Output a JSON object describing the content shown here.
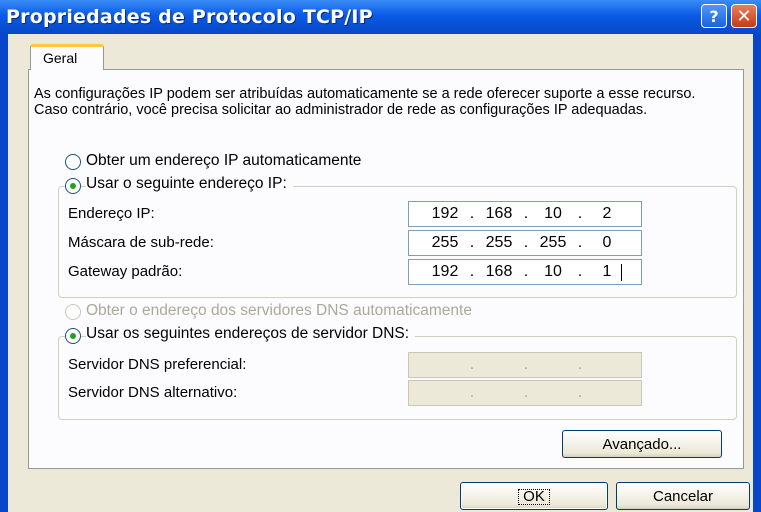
{
  "window": {
    "title": "Propriedades de Protocolo TCP/IP",
    "help_glyph": "?",
    "close_glyph": "✕"
  },
  "tabs": [
    {
      "label": "Geral",
      "active": true
    }
  ],
  "general": {
    "description": "As configurações IP podem ser atribuídas automaticamente se a rede oferecer suporte a esse recurso. Caso contrário, você precisa solicitar ao administrador de rede as configurações IP adequadas.",
    "ip_auto_label": "Obter um endereço IP automaticamente",
    "ip_manual_label": "Usar o seguinte endereço IP:",
    "ip_mode": "manual",
    "ip_fields": [
      {
        "label": "Endereço IP:",
        "octets": [
          "192",
          "168",
          "10",
          "2"
        ]
      },
      {
        "label": "Máscara de sub-rede:",
        "octets": [
          "255",
          "255",
          "255",
          "0"
        ]
      },
      {
        "label": "Gateway padrão:",
        "octets": [
          "192",
          "168",
          "10",
          "1"
        ]
      }
    ],
    "dns_auto_label": "Obter o endereço dos servidores DNS automaticamente",
    "dns_manual_label": "Usar os seguintes endereços de servidor DNS:",
    "dns_mode": "manual",
    "dns_fields": [
      {
        "label": "Servidor DNS preferencial:",
        "octets": [
          "",
          "",
          "",
          ""
        ]
      },
      {
        "label": "Servidor DNS alternativo:",
        "octets": [
          "",
          "",
          "",
          ""
        ]
      }
    ],
    "ip_separator": "."
  },
  "buttons": {
    "advanced": "Avançado...",
    "ok": "OK",
    "cancel": "Cancelar"
  },
  "colors": {
    "title_bar": "#0a5ae6",
    "dialog_bg": "#ece9d8",
    "panel_bg": "#fcfcfe",
    "tab_highlight": "#ffc83c",
    "radio_dot": "#21a121",
    "disabled_text": "#aca899"
  }
}
